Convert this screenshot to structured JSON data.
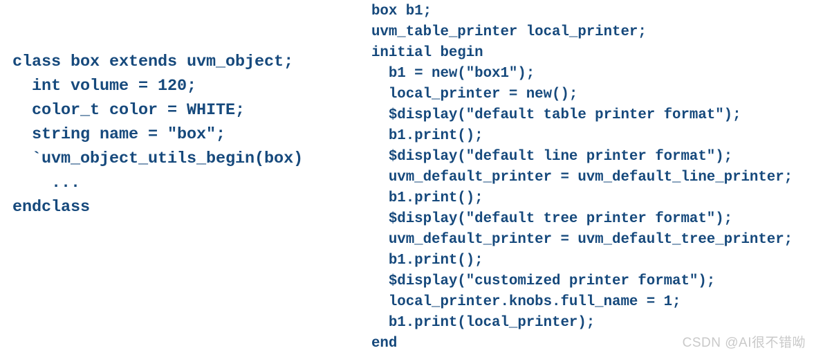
{
  "page": {
    "background_color": "#ffffff",
    "code_color": "#16497c",
    "watermark_color": "#c9c9c9"
  },
  "left_snippet": {
    "name": "uvm-object-class-declaration",
    "language": "SystemVerilog",
    "lines": [
      "class box extends uvm_object;",
      "  int volume = 120;",
      "  color_t color = WHITE;",
      "  string name = \"box\";",
      "  `uvm_object_utils_begin(box)",
      "    ...",
      "endclass"
    ]
  },
  "right_snippet": {
    "name": "uvm-printer-testbench-block",
    "language": "SystemVerilog",
    "lines": [
      "box b1;",
      "uvm_table_printer local_printer;",
      "initial begin",
      "  b1 = new(\"box1\");",
      "  local_printer = new();",
      "  $display(\"default table printer format\");",
      "  b1.print();",
      "  $display(\"default line printer format\");",
      "  uvm_default_printer = uvm_default_line_printer;",
      "  b1.print();",
      "  $display(\"default tree printer format\");",
      "  uvm_default_printer = uvm_default_tree_printer;",
      "  b1.print();",
      "  $display(\"customized printer format\");",
      "  local_printer.knobs.full_name = 1;",
      "  b1.print(local_printer);",
      "end"
    ]
  },
  "watermark": {
    "text": "CSDN @AI很不错呦"
  }
}
